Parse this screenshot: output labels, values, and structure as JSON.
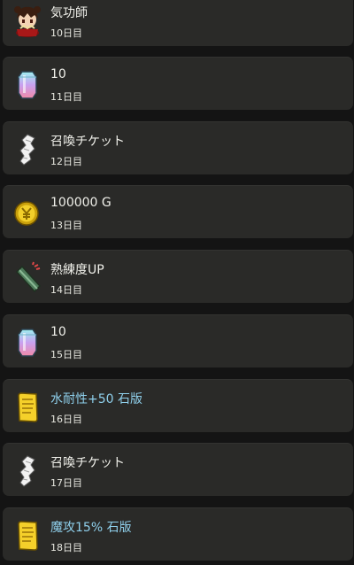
{
  "rewards": [
    {
      "title": "気功師",
      "day": "10日目",
      "icon": "character-avatar-icon",
      "special": false
    },
    {
      "title": "10",
      "day": "11日目",
      "icon": "crystal-gem-icon",
      "special": false
    },
    {
      "title": "召喚チケット",
      "day": "12日目",
      "icon": "summon-ticket-icon",
      "special": false
    },
    {
      "title": "100000 G",
      "day": "13日目",
      "icon": "gold-coin-icon",
      "special": false
    },
    {
      "title": "熟練度UP",
      "day": "14日目",
      "icon": "proficiency-scroll-icon",
      "special": false
    },
    {
      "title": "10",
      "day": "15日目",
      "icon": "crystal-gem-icon",
      "special": false
    },
    {
      "title": "水耐性+50 石版",
      "day": "16日目",
      "icon": "stone-tablet-icon",
      "special": true
    },
    {
      "title": "召喚チケット",
      "day": "17日目",
      "icon": "summon-ticket-icon",
      "special": false
    },
    {
      "title": "魔攻15% 石版",
      "day": "18日目",
      "icon": "stone-tablet-icon",
      "special": true
    }
  ],
  "colors": {
    "background": "#141414",
    "card": "#2a2a28",
    "text": "#f0f0ea",
    "special_text": "#8fd0ec"
  }
}
